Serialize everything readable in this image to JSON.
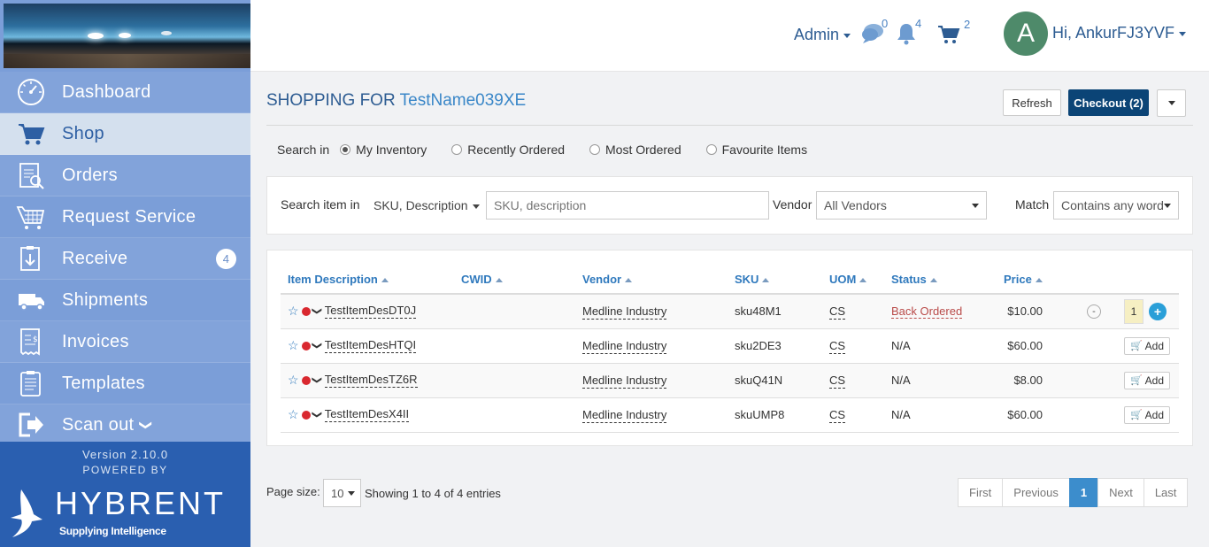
{
  "sidebar": {
    "items": [
      {
        "label": "Dashboard",
        "icon": "dashboard-icon"
      },
      {
        "label": "Shop",
        "icon": "cart-icon"
      },
      {
        "label": "Orders",
        "icon": "orders-icon"
      },
      {
        "label": "Request Service",
        "icon": "request-service-icon"
      },
      {
        "label": "Receive",
        "icon": "receive-icon",
        "badge": "4"
      },
      {
        "label": "Shipments",
        "icon": "truck-icon"
      },
      {
        "label": "Invoices",
        "icon": "invoice-icon"
      },
      {
        "label": "Templates",
        "icon": "templates-icon"
      },
      {
        "label": "Scan out",
        "icon": "scan-out-icon"
      }
    ],
    "version": "Version 2.10.0",
    "powered_by": "POWERED BY",
    "logo_word": "HYBRENT",
    "logo_tag": "Supplying Intelligence"
  },
  "topbar": {
    "admin": "Admin",
    "messages_count": "0",
    "notifications_count": "4",
    "cart_count": "2",
    "avatar_letter": "A",
    "greeting": "Hi, AnkurFJ3YVF"
  },
  "page": {
    "title_prefix": "SHOPPING FOR",
    "title_name": "TestName039XE",
    "refresh": "Refresh",
    "checkout": "Checkout (2)"
  },
  "search_in": {
    "label": "Search in",
    "options": [
      "My Inventory",
      "Recently Ordered",
      "Most Ordered",
      "Favourite Items"
    ],
    "selected": "My Inventory"
  },
  "search_bar": {
    "label": "Search item in",
    "scope": "SKU, Description",
    "placeholder": "SKU, description",
    "vendor_label": "Vendor",
    "vendor_value": "All Vendors",
    "match_label": "Match",
    "match_value": "Contains any word"
  },
  "table": {
    "columns": [
      "Item Description",
      "CWID",
      "Vendor",
      "SKU",
      "UOM",
      "Status",
      "Price"
    ],
    "rows": [
      {
        "desc": "TestItemDesDT0J",
        "cwid": "",
        "vendor": "Medline Industry",
        "sku": "sku48M1",
        "uom": "CS",
        "status": "Back Ordered",
        "price": "$10.00",
        "qty": "1",
        "action": "qty"
      },
      {
        "desc": "TestItemDesHTQI",
        "cwid": "",
        "vendor": "Medline Industry",
        "sku": "sku2DE3",
        "uom": "CS",
        "status": "N/A",
        "price": "$60.00",
        "action": "Add"
      },
      {
        "desc": "TestItemDesTZ6R",
        "cwid": "",
        "vendor": "Medline Industry",
        "sku": "skuQ41N",
        "uom": "CS",
        "status": "N/A",
        "price": "$8.00",
        "action": "Add"
      },
      {
        "desc": "TestItemDesX4II",
        "cwid": "",
        "vendor": "Medline Industry",
        "sku": "skuUMP8",
        "uom": "CS",
        "status": "N/A",
        "price": "$60.00",
        "action": "Add"
      }
    ]
  },
  "footer": {
    "page_size_label": "Page size:",
    "page_size": "10",
    "showing": "Showing 1 to 4 of 4 entries",
    "pager": [
      "First",
      "Previous",
      "1",
      "Next",
      "Last"
    ]
  },
  "colors": {
    "sidebar": "#7b9ed8",
    "sidebar_footer": "#2a5fb0",
    "accent": "#2f79bd",
    "checkout": "#0b4476",
    "status_back": "#b94a48"
  }
}
